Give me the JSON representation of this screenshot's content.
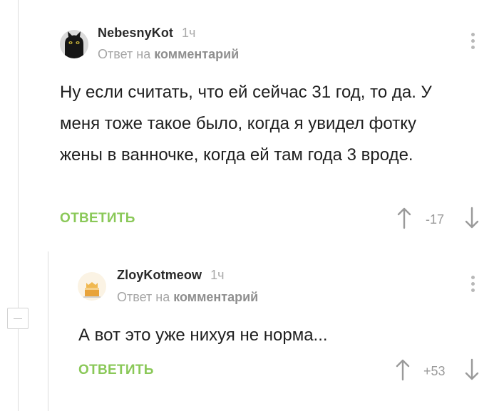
{
  "comments": [
    {
      "author": "NebesnyKot",
      "time": "1ч",
      "reply_prefix": "Ответ на",
      "reply_link": "комментарий",
      "text": "Ну если считать, что ей сейчас 31 год, то да. У меня тоже такое было, когда я увидел фотку жены в ванночке, когда ей там года 3 вроде.",
      "reply_label": "ОТВЕТИТЬ",
      "score": "-17",
      "avatar_icon": "black-cat-avatar"
    },
    {
      "author": "ZloyKotmeow",
      "time": "1ч",
      "reply_prefix": "Ответ на",
      "reply_link": "комментарий",
      "text": "А вот это уже нихуя не норма...",
      "reply_label": "ОТВЕТИТЬ",
      "score": "+53",
      "avatar_icon": "cake-cat-avatar"
    }
  ],
  "colors": {
    "accent_green": "#8ac858",
    "muted_gray": "#a5a5a5",
    "text": "#1f1f1f"
  }
}
